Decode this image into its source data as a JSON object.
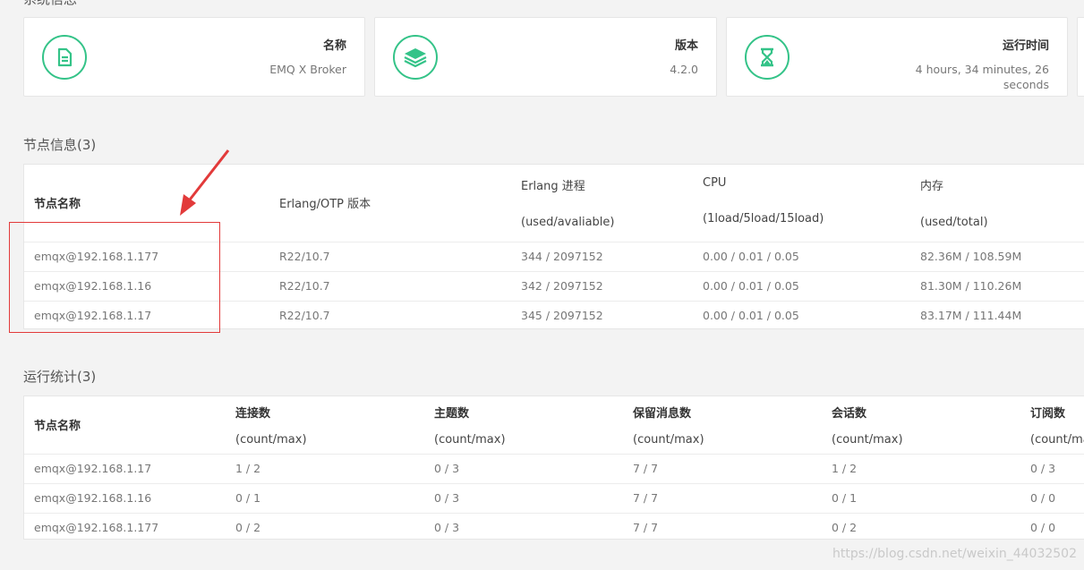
{
  "system": {
    "title": "系统信息",
    "cards": [
      {
        "icon": "document-icon",
        "label": "名称",
        "value": "EMQ X Broker"
      },
      {
        "icon": "layers-icon",
        "label": "版本",
        "value": "4.2.0"
      },
      {
        "icon": "hourglass-icon",
        "label": "运行时间",
        "value_line1": "4 hours, 34 minutes, 26",
        "value_line2": "seconds"
      }
    ]
  },
  "nodes": {
    "title": "节点信息(3)",
    "headers": {
      "name": "节点名称",
      "otp": "Erlang/OTP 版本",
      "proc_top": "Erlang 进程",
      "proc_sub": "(used/avaliable)",
      "cpu_top": "CPU",
      "cpu_sub": "(1load/5load/15load)",
      "mem_top": "内存",
      "mem_sub": "(used/total)"
    },
    "rows": [
      {
        "name": "emqx@192.168.1.177",
        "otp": "R22/10.7",
        "proc": "344 / 2097152",
        "cpu": "0.00 / 0.01 / 0.05",
        "mem": "82.36M / 108.59M"
      },
      {
        "name": "emqx@192.168.1.16",
        "otp": "R22/10.7",
        "proc": "342 / 2097152",
        "cpu": "0.00 / 0.01 / 0.05",
        "mem": "81.30M / 110.26M"
      },
      {
        "name": "emqx@192.168.1.17",
        "otp": "R22/10.7",
        "proc": "345 / 2097152",
        "cpu": "0.00 / 0.01 / 0.05",
        "mem": "83.17M / 111.44M"
      }
    ]
  },
  "stats": {
    "title": "运行统计(3)",
    "headers": {
      "name": "节点名称",
      "conn": "连接数",
      "topics": "主题数",
      "retained": "保留消息数",
      "sessions": "会话数",
      "subs": "订阅数",
      "sub": "(count/max)"
    },
    "rows": [
      {
        "name": "emqx@192.168.1.17",
        "conn": "1 / 2",
        "topics": "0 / 3",
        "retained": "7 / 7",
        "sessions": "1 / 2",
        "subs": "0 / 3"
      },
      {
        "name": "emqx@192.168.1.16",
        "conn": "0 / 1",
        "topics": "0 / 3",
        "retained": "7 / 7",
        "sessions": "0 / 1",
        "subs": "0 / 0"
      },
      {
        "name": "emqx@192.168.1.177",
        "conn": "0 / 2",
        "topics": "0 / 3",
        "retained": "7 / 7",
        "sessions": "0 / 2",
        "subs": "0 / 0"
      }
    ]
  },
  "watermark": "https://blog.csdn.net/weixin_44032502",
  "colors": {
    "accent": "#34c388",
    "annotation": "#e23a3a"
  }
}
